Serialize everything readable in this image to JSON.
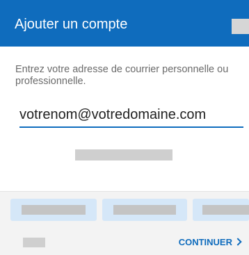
{
  "header": {
    "title": "Ajouter un compte"
  },
  "prompt_text": "Entrez votre adresse de courrier personnelle ou professionnelle.",
  "email_input": {
    "value": "votrenom@votredomaine.com"
  },
  "footer": {
    "continue_label": "CONTINUER",
    "continue_icon": "chevron-right-icon"
  },
  "colors": {
    "accent": "#0f6cbd",
    "suggestion_bg": "#d5e7f8",
    "footer_bg": "#f3f3f3"
  }
}
